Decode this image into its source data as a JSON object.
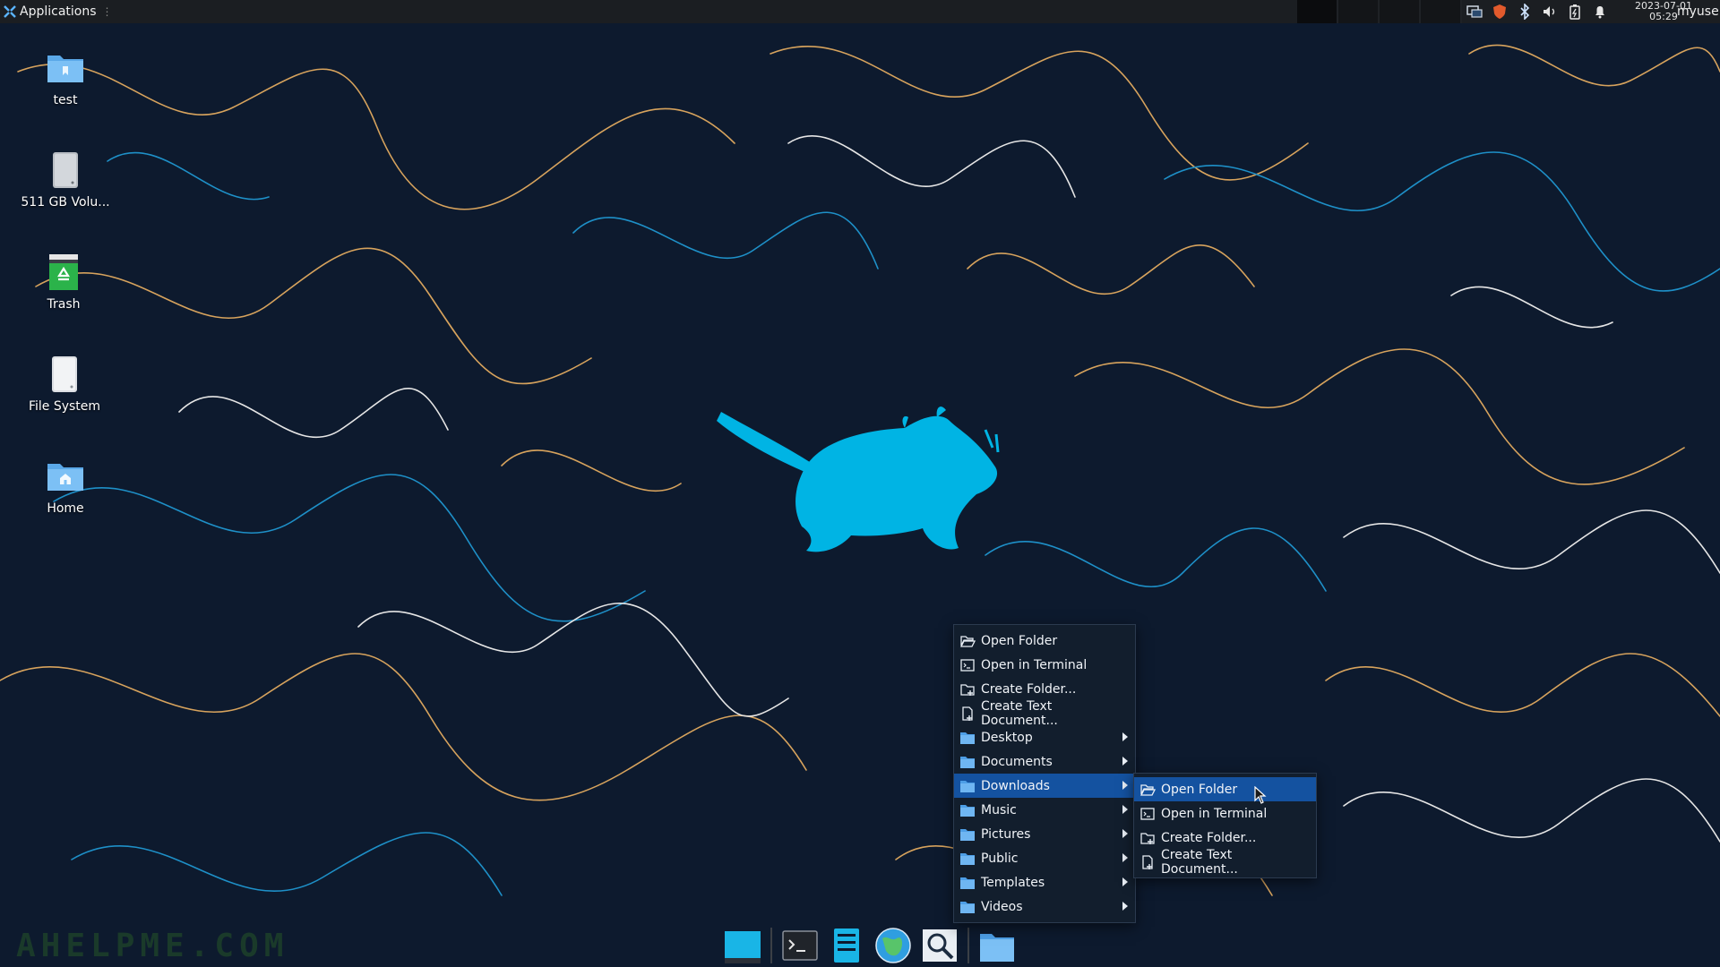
{
  "panel": {
    "apps_label": "Applications",
    "date": "2023-07-01",
    "time": "05:29",
    "user": "myuser"
  },
  "desktop": {
    "icons": [
      {
        "label": "test",
        "icon": "folder-icon"
      },
      {
        "label": "511 GB Volu...",
        "icon": "drive-icon"
      },
      {
        "label": "Trash",
        "icon": "trash-icon"
      },
      {
        "label": "File System",
        "icon": "filesystem-icon"
      },
      {
        "label": "Home",
        "icon": "home-folder-icon"
      }
    ]
  },
  "watermark": "AHELPME.COM",
  "menu": {
    "items": [
      {
        "label": "Open Folder",
        "icon": "open-folder-icon"
      },
      {
        "label": "Open in Terminal",
        "icon": "terminal-icon"
      },
      {
        "label": "Create Folder...",
        "icon": "create-folder-icon"
      },
      {
        "label": "Create Text Document...",
        "icon": "create-document-icon"
      },
      {
        "label": "Desktop",
        "icon": "folder-icon"
      },
      {
        "label": "Documents",
        "icon": "folder-icon"
      },
      {
        "label": "Downloads",
        "icon": "folder-icon"
      },
      {
        "label": "Music",
        "icon": "folder-icon"
      },
      {
        "label": "Pictures",
        "icon": "folder-icon"
      },
      {
        "label": "Public",
        "icon": "folder-icon"
      },
      {
        "label": "Templates",
        "icon": "folder-icon"
      },
      {
        "label": "Videos",
        "icon": "folder-icon"
      }
    ],
    "submenu": [
      {
        "label": "Open Folder",
        "icon": "open-folder-icon"
      },
      {
        "label": "Open in Terminal",
        "icon": "terminal-icon"
      },
      {
        "label": "Create Folder...",
        "icon": "create-folder-icon"
      },
      {
        "label": "Create Text Document...",
        "icon": "create-document-icon"
      }
    ]
  },
  "dock": [
    {
      "icon": "show-desktop-icon"
    },
    {
      "icon": "terminal-icon"
    },
    {
      "icon": "file-manager-icon"
    },
    {
      "icon": "web-browser-icon"
    },
    {
      "icon": "app-finder-icon"
    },
    {
      "icon": "home-folder-icon"
    }
  ],
  "colors": {
    "background": "#0d1a2e",
    "contour_orange": "#d7a35d",
    "contour_blue": "#1e90c8",
    "contour_white": "#e6e6e6",
    "mouse_logo": "#00b4e4",
    "menu_bg": "#121e2d",
    "menu_highlight": "#1452a0",
    "panel_bg": "#1b1e22"
  }
}
